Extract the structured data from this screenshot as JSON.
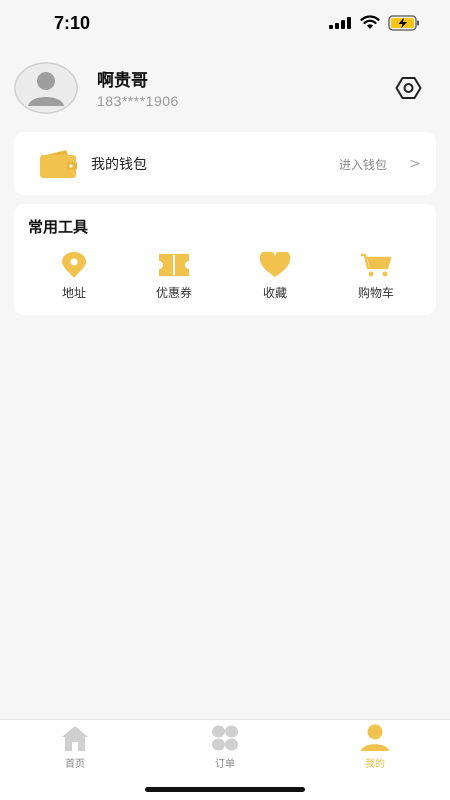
{
  "status_bar": {
    "time": "7:10"
  },
  "profile": {
    "name": "啊贵哥",
    "phone": "183****1906"
  },
  "wallet": {
    "title": "我的钱包",
    "link": "进入钱包",
    "chevron": ">"
  },
  "tools": {
    "title": "常用工具",
    "items": [
      {
        "label": "地址",
        "icon": "location-icon"
      },
      {
        "label": "优惠券",
        "icon": "coupon-icon"
      },
      {
        "label": "收藏",
        "icon": "heart-icon"
      },
      {
        "label": "购物车",
        "icon": "cart-icon"
      }
    ]
  },
  "tabbar": {
    "items": [
      {
        "label": "首页",
        "icon": "home-icon",
        "active": false
      },
      {
        "label": "订单",
        "icon": "orders-icon",
        "active": false
      },
      {
        "label": "我的",
        "icon": "profile-icon",
        "active": true
      }
    ]
  },
  "colors": {
    "accent": "#F2C24F",
    "inactive": "#D0D0D0",
    "background": "#F6F6F6"
  }
}
